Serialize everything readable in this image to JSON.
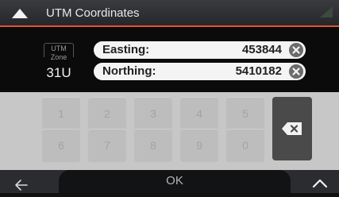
{
  "header": {
    "title": "UTM Coordinates",
    "up_icon": "triangle-up-icon",
    "signal_icon": "signal-icon"
  },
  "zone": {
    "label_line1": "UTM",
    "label_line2": "Zone",
    "value": "31U"
  },
  "fields": [
    {
      "label": "Easting:",
      "value": "453844",
      "clear_icon": "clear-icon"
    },
    {
      "label": "Northing:",
      "value": "5410182",
      "clear_icon": "clear-icon"
    }
  ],
  "keypad": {
    "row1": [
      "1",
      "2",
      "3",
      "4",
      "5"
    ],
    "row2": [
      "6",
      "7",
      "8",
      "9",
      "0"
    ],
    "backspace_icon": "backspace-icon"
  },
  "bottom": {
    "back_icon": "back-arrow-icon",
    "ok_label": "OK",
    "menu_icon": "chevron-up-icon"
  },
  "colors": {
    "accent": "#e0552e",
    "field_bg": "#f4f4f4",
    "keypad_bg": "#c7c7c7"
  }
}
